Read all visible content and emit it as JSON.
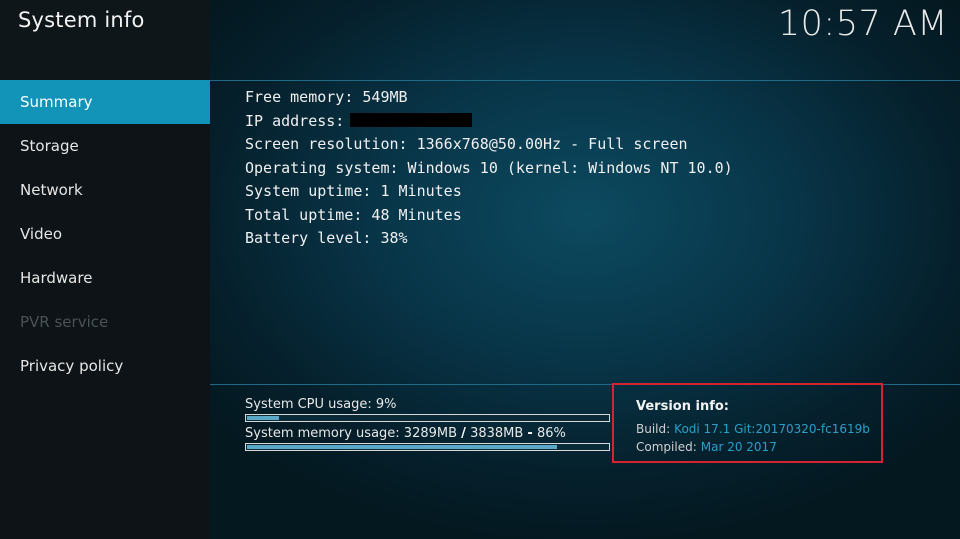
{
  "window": {
    "title": "System info",
    "clock": "10:57 AM"
  },
  "sidebar": {
    "items": [
      {
        "label": "Summary",
        "state": "active"
      },
      {
        "label": "Storage",
        "state": "normal"
      },
      {
        "label": "Network",
        "state": "normal"
      },
      {
        "label": "Video",
        "state": "normal"
      },
      {
        "label": "Hardware",
        "state": "normal"
      },
      {
        "label": "PVR service",
        "state": "disabled"
      },
      {
        "label": "Privacy policy",
        "state": "normal"
      }
    ]
  },
  "summary": {
    "free_memory": "Free memory: 549MB",
    "ip_address_label": "IP address:",
    "screen_resolution": "Screen resolution: 1366x768@50.00Hz - Full screen",
    "operating_system": "Operating system: Windows 10 (kernel: Windows NT 10.0)",
    "system_uptime": "System uptime: 1 Minutes",
    "total_uptime": "Total uptime: 48 Minutes",
    "battery_level": "Battery level: 38%"
  },
  "usage": {
    "cpu_label": "System CPU usage: 9%",
    "cpu_fraction": 0.09,
    "memory_label_part1": "System memory usage: 3289MB",
    "memory_sep1": "/",
    "memory_label_part2": "3838MB",
    "memory_sep2": "-",
    "memory_label_part3": "86%",
    "memory_fraction": 0.86
  },
  "version": {
    "title": "Version info:",
    "build_label": "Build:",
    "build_value": "Kodi 17.1 Git:20170320-fc1619b",
    "compiled_label": "Compiled:",
    "compiled_value": "Mar 20 2017"
  },
  "colors": {
    "accent": "#1294b8",
    "highlight_border": "#d6232d",
    "link_value": "#2b9fc9"
  }
}
